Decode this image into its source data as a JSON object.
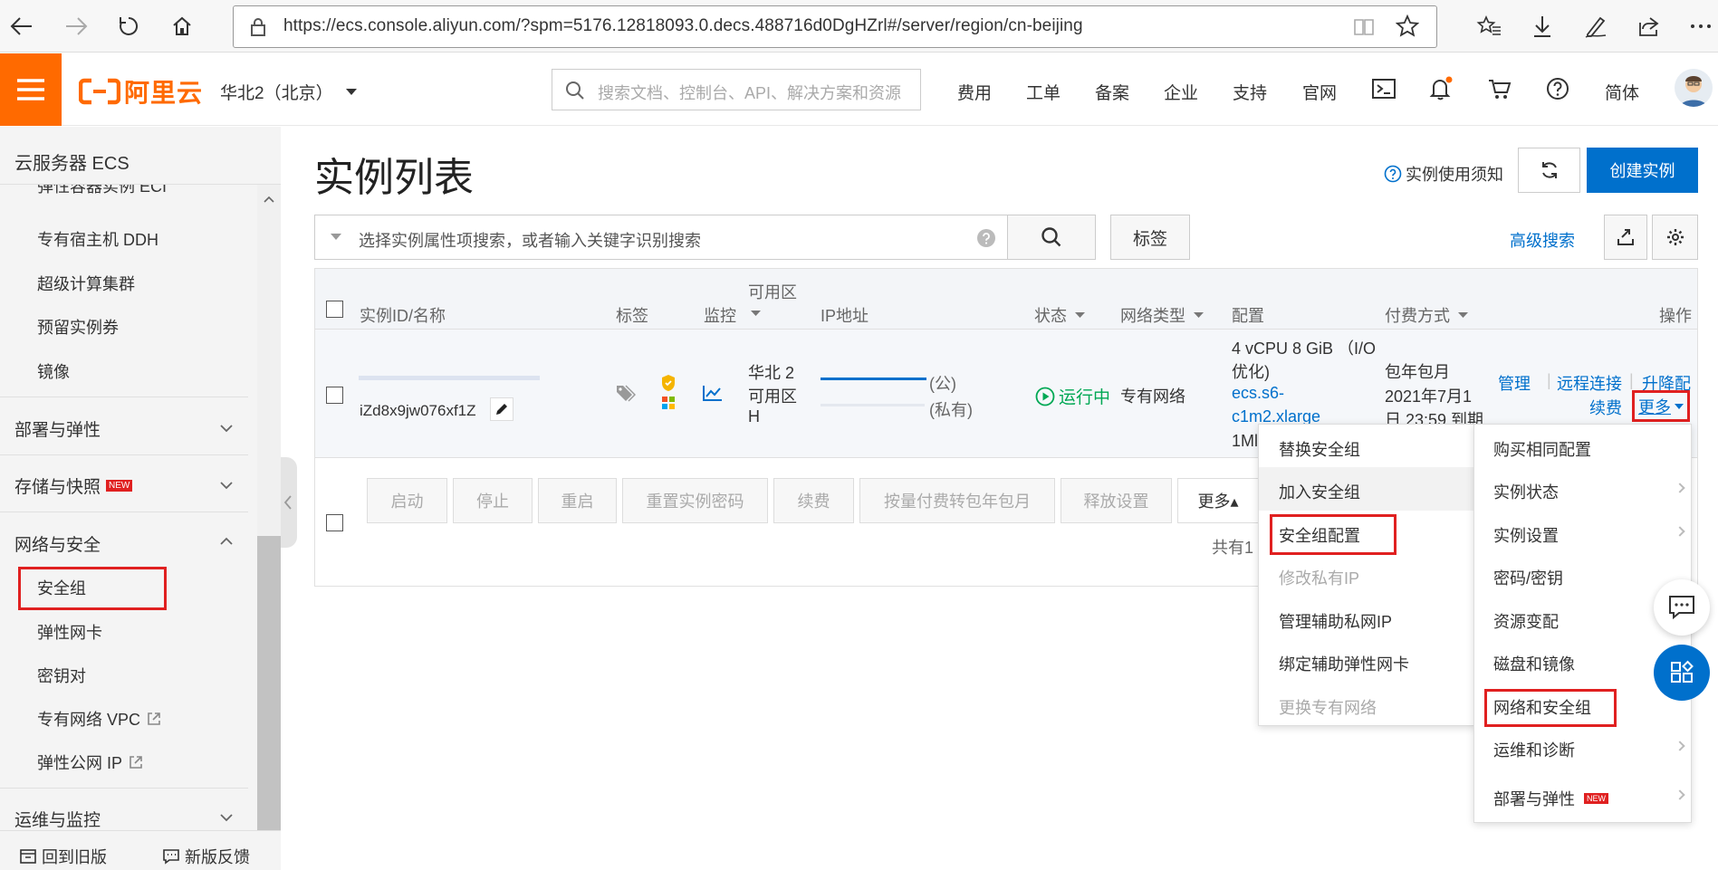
{
  "browser": {
    "url": "https://ecs.console.aliyun.com/?spm=5176.12818093.0.decs.488716d0DgHZrl#/server/region/cn-beijing"
  },
  "topnav": {
    "logo_text": "阿里云",
    "region": "华北2（北京）",
    "search_placeholder": "搜索文档、控制台、API、解决方案和资源",
    "links": [
      "费用",
      "工单",
      "备案",
      "企业",
      "支持",
      "官网"
    ],
    "lang": "简体"
  },
  "sidebar": {
    "title": "云服务器 ECS",
    "partial_top": "弹性容器实例 ECI",
    "items_top": [
      "专有宿主机 DDH",
      "超级计算集群",
      "预留实例券",
      "镜像"
    ],
    "group_deploy": "部署与弹性",
    "group_storage": "存储与快照",
    "new_badge": "NEW",
    "group_network": "网络与安全",
    "network_items": [
      "安全组",
      "弹性网卡",
      "密钥对",
      "专有网络 VPC",
      "弹性公网 IP"
    ],
    "group_ops": "运维与监控",
    "back_old": "回到旧版",
    "feedback": "新版反馈"
  },
  "main": {
    "page_title": "实例列表",
    "notice_link": "实例使用须知",
    "create_button": "创建实例",
    "search_placeholder": "选择实例属性项搜索，或者输入关键字识别搜索",
    "tag_button": "标签",
    "advanced_search": "高级搜索",
    "table": {
      "headers": {
        "id": "实例ID/名称",
        "tag": "标签",
        "monitor": "监控",
        "zone": "可用区",
        "ip": "IP地址",
        "status": "状态",
        "network": "网络类型",
        "config": "配置",
        "billing": "付费方式",
        "ops": "操作"
      },
      "row": {
        "instance_id": "iZd8x9jw076xf1Z",
        "zone_line1": "华北 2",
        "zone_line2": "可用区",
        "zone_line3": "H",
        "ip_public_suffix": "(公)",
        "ip_private_suffix": "(私有)",
        "status": "运行中",
        "network": "专有网络",
        "config_line1": "4 vCPU 8 GiB （I/O",
        "config_line2": "优化)",
        "config_spec1": "ecs.s6-",
        "config_spec2": "c1m2.xlarge",
        "config_line4": "1Ml",
        "billing_line1": "包年包月",
        "billing_line2": "2021年7月1",
        "billing_line3": "日 23:59 到期",
        "op_manage": "管理",
        "op_remote": "远程连接",
        "op_upgrade": "升降配",
        "op_renew": "续费",
        "op_more": "更多"
      }
    },
    "batch_buttons": [
      "启动",
      "停止",
      "重启",
      "重置实例密码",
      "续费",
      "按量付费转包年包月",
      "释放设置"
    ],
    "batch_more": "更多▴",
    "total_text": "共有1"
  },
  "dropdown_network": {
    "items": [
      "替换安全组",
      "加入安全组",
      "安全组配置",
      "修改私有IP",
      "管理辅助私网IP",
      "绑定辅助弹性网卡",
      "更换专有网络"
    ]
  },
  "dropdown_more": {
    "items": [
      "购买相同配置",
      "实例状态",
      "实例设置",
      "密码/密钥",
      "资源变配",
      "磁盘和镜像",
      "网络和安全组",
      "运维和诊断",
      "部署与弹性"
    ],
    "new_badge": "NEW"
  },
  "colors": {
    "brand": "#ff6a00",
    "primary": "#0070cc",
    "highlight": "#e02020",
    "running": "#00a854"
  }
}
